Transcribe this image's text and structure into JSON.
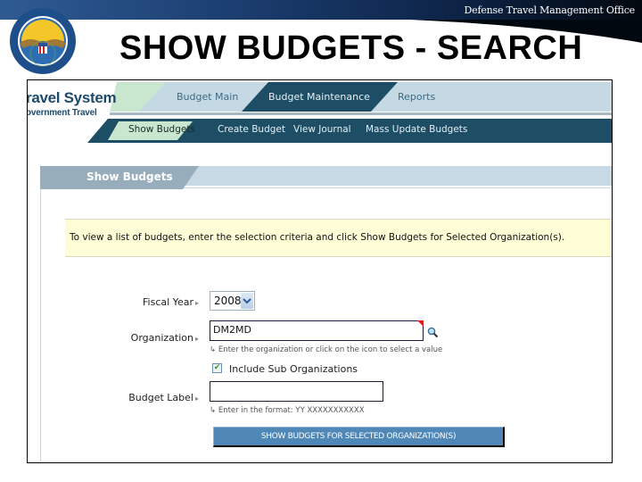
{
  "slide": {
    "org_name": "Defense Travel Management Office",
    "title": "SHOW BUDGETS - SEARCH",
    "seal_icon": "dod-seal-icon"
  },
  "app": {
    "brand_line1": "ravel System",
    "brand_line2": "overnment Travel"
  },
  "nav": {
    "tabs": [
      {
        "label": "Budget Main",
        "active": false
      },
      {
        "label": "Budget Maintenance",
        "active": true
      },
      {
        "label": "Reports",
        "active": false
      }
    ],
    "subnav": [
      {
        "label": "Show Budgets",
        "active": true
      },
      {
        "label": "Create Budget",
        "active": false
      },
      {
        "label": "View Journal",
        "active": false
      },
      {
        "label": "Mass Update Budgets",
        "active": false
      }
    ]
  },
  "section": {
    "title": "Show Budgets"
  },
  "info_message": "To view a list of budgets, enter the selection criteria and click Show Budgets for Selected Organization(s).",
  "form": {
    "fiscal_year": {
      "label": "Fiscal Year",
      "value": "2008"
    },
    "organization": {
      "label": "Organization",
      "value": "DM2MD",
      "hint": "Enter the organization or click on the icon to select a value",
      "lookup_icon": "magnifier-icon"
    },
    "include_sub_orgs": {
      "label": "Include Sub Organizations",
      "checked": true
    },
    "budget_label": {
      "label": "Budget Label",
      "value": "",
      "hint": "Enter in the format: YY XXXXXXXXXXX"
    },
    "submit_label": "SHOW BUDGETS FOR SELECTED ORGANIZATION(S)"
  },
  "colors": {
    "nav_dark": "#1d4e66",
    "nav_light": "#c5d9e4",
    "nav_green": "#c9e6cf",
    "section_bar": "#98adbb",
    "info_bg": "#fffdd6",
    "button": "#4f87b7"
  }
}
